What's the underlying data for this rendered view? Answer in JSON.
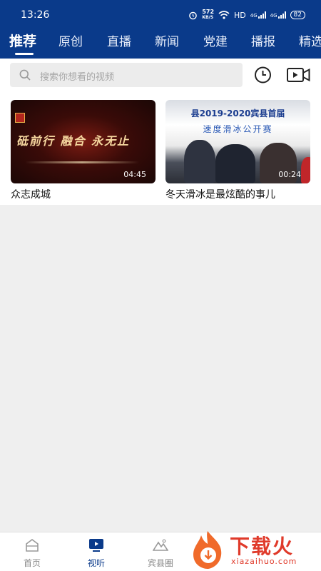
{
  "status_bar": {
    "time": "13:26",
    "net_speed_value": "572",
    "net_speed_unit": "KB/S",
    "hd_label": "HD",
    "signal1": "4G",
    "signal2": "4G",
    "battery": "82"
  },
  "tabs": [
    {
      "label": "推荐",
      "active": true
    },
    {
      "label": "原创"
    },
    {
      "label": "直播"
    },
    {
      "label": "新闻"
    },
    {
      "label": "党建"
    },
    {
      "label": "播报"
    },
    {
      "label": "精选"
    }
  ],
  "search": {
    "placeholder": "搜索你想看的视频"
  },
  "videos": [
    {
      "title": "众志成城",
      "duration": "04:45",
      "thumb_caption": "砥前行   融合   永无止"
    },
    {
      "title": "冬天滑冰是最炫酷的事儿",
      "duration": "00:24",
      "thumb_banner": "县2019-2020宾县首届",
      "thumb_banner2": "速度滑冰公开赛"
    }
  ],
  "bottom_nav": [
    {
      "label": "首页",
      "icon": "home-icon"
    },
    {
      "label": "视听",
      "icon": "tv-icon",
      "active": true
    },
    {
      "label": "宾县圈",
      "icon": "mountain-icon"
    }
  ],
  "watermark": {
    "text": "下载火",
    "domain": "xiazaihuo.com"
  },
  "colors": {
    "brand": "#0a3a8a",
    "background": "#efefef",
    "watermark": "#e03a2a"
  }
}
